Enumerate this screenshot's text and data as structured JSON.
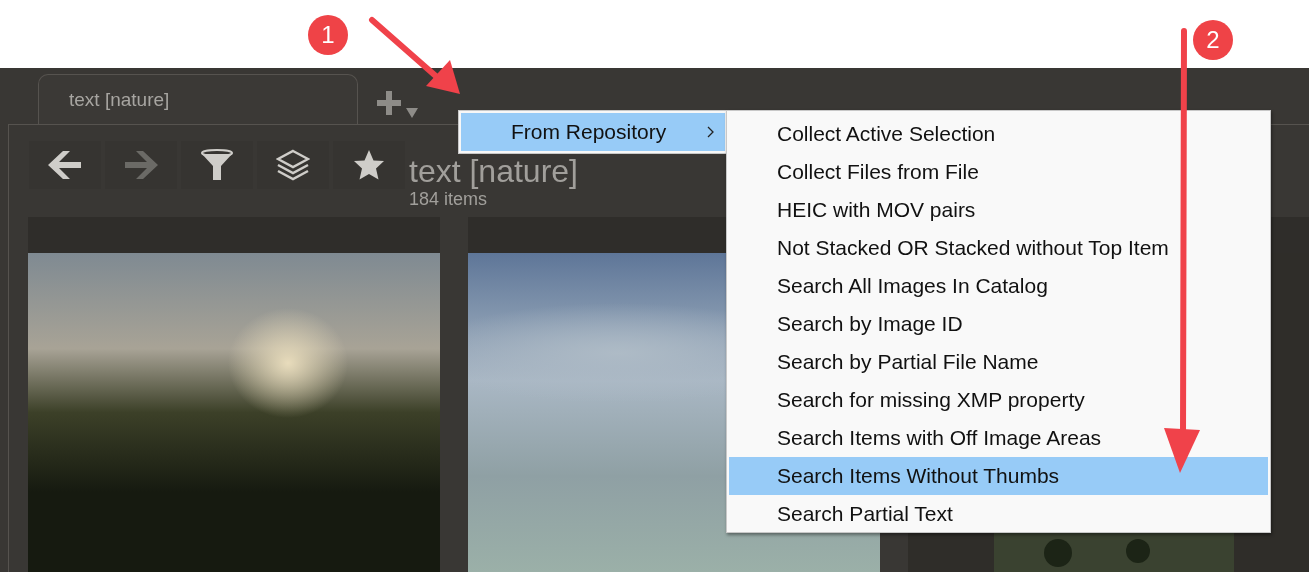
{
  "annotations": [
    {
      "label": "1"
    },
    {
      "label": "2"
    }
  ],
  "tabs": [
    {
      "label": "text [nature]",
      "selected": true
    }
  ],
  "toolbar": [
    {
      "kind": "back",
      "disabled": false
    },
    {
      "kind": "forward",
      "disabled": true
    },
    {
      "kind": "filter",
      "disabled": false
    },
    {
      "kind": "stack",
      "disabled": false
    },
    {
      "kind": "star",
      "disabled": false
    }
  ],
  "collection": {
    "title": "text [nature]",
    "count": "184 items"
  },
  "menu": {
    "items": [
      {
        "label": "From Repository",
        "submenu": true,
        "selected": true
      }
    ]
  },
  "submenu": {
    "items": [
      {
        "label": "Collect Active Selection",
        "selected": false
      },
      {
        "label": "Collect Files from File",
        "selected": false
      },
      {
        "label": "HEIC with MOV pairs",
        "selected": false
      },
      {
        "label": "Not Stacked OR Stacked without Top Item",
        "selected": false
      },
      {
        "label": "Search All Images In Catalog",
        "selected": false
      },
      {
        "label": "Search by Image ID",
        "selected": false
      },
      {
        "label": "Search by Partial File Name",
        "selected": false
      },
      {
        "label": "Search for missing XMP property",
        "selected": false
      },
      {
        "label": "Search Items with Off Image Areas",
        "selected": false
      },
      {
        "label": "Search Items Without Thumbs",
        "selected": true
      },
      {
        "label": "Search Partial Text",
        "selected": false
      }
    ]
  }
}
